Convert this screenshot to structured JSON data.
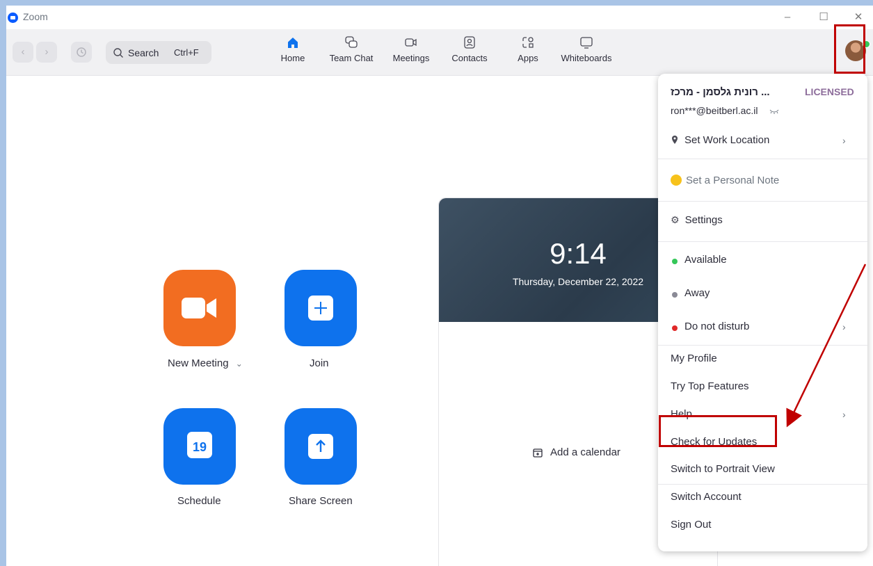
{
  "window": {
    "title": "Zoom"
  },
  "titlebar": {
    "minimize": "–",
    "maximize": "☐",
    "close": "✕"
  },
  "toolbar": {
    "back": "‹",
    "forward": "›",
    "search_label": "Search",
    "search_shortcut": "Ctrl+F",
    "tabs": [
      {
        "label": "Home",
        "icon": "home-icon",
        "active": true
      },
      {
        "label": "Team Chat",
        "icon": "chat-icon"
      },
      {
        "label": "Meetings",
        "icon": "video-icon"
      },
      {
        "label": "Contacts",
        "icon": "contacts-icon"
      },
      {
        "label": "Apps",
        "icon": "apps-icon"
      },
      {
        "label": "Whiteboards",
        "icon": "whiteboard-icon"
      }
    ],
    "accent_color": "#0e72ed"
  },
  "home": {
    "actions": [
      {
        "label": "New Meeting",
        "color": "#f26d21",
        "icon": "video-camera-icon"
      },
      {
        "label": "Join",
        "color": "#0e72ed",
        "icon": "plus-icon"
      },
      {
        "label": "Schedule",
        "color": "#0e72ed",
        "icon": "calendar-icon",
        "calendar_day": "19"
      },
      {
        "label": "Share Screen",
        "color": "#0e72ed",
        "icon": "upload-arrow-icon"
      }
    ],
    "new_meeting_chevron": "⌄"
  },
  "calendar_card": {
    "time": "9:14",
    "date": "Thursday, December 22, 2022",
    "add_calendar": "Add a calendar"
  },
  "profile_menu": {
    "user_name": "... רונית גלסמן - מרכז",
    "license": "LICENSED",
    "email": "ron***@beitberl.ac.il",
    "items": {
      "set_work_location": "Set Work Location",
      "personal_note": "Set a Personal Note",
      "settings": "Settings",
      "available": "Available",
      "away": "Away",
      "do_not_disturb": "Do not disturb",
      "my_profile": "My Profile",
      "try_top_features": "Try Top Features",
      "help": "Help",
      "check_for_updates": "Check for Updates",
      "switch_portrait": "Switch to Portrait View",
      "switch_account": "Switch Account",
      "sign_out": "Sign Out"
    },
    "chevron": "›",
    "status_colors": {
      "available": "#35c759",
      "away": "#8a8a96",
      "dnd": "#e02828"
    }
  },
  "annotation": {
    "highlight_color": "#c00000"
  }
}
